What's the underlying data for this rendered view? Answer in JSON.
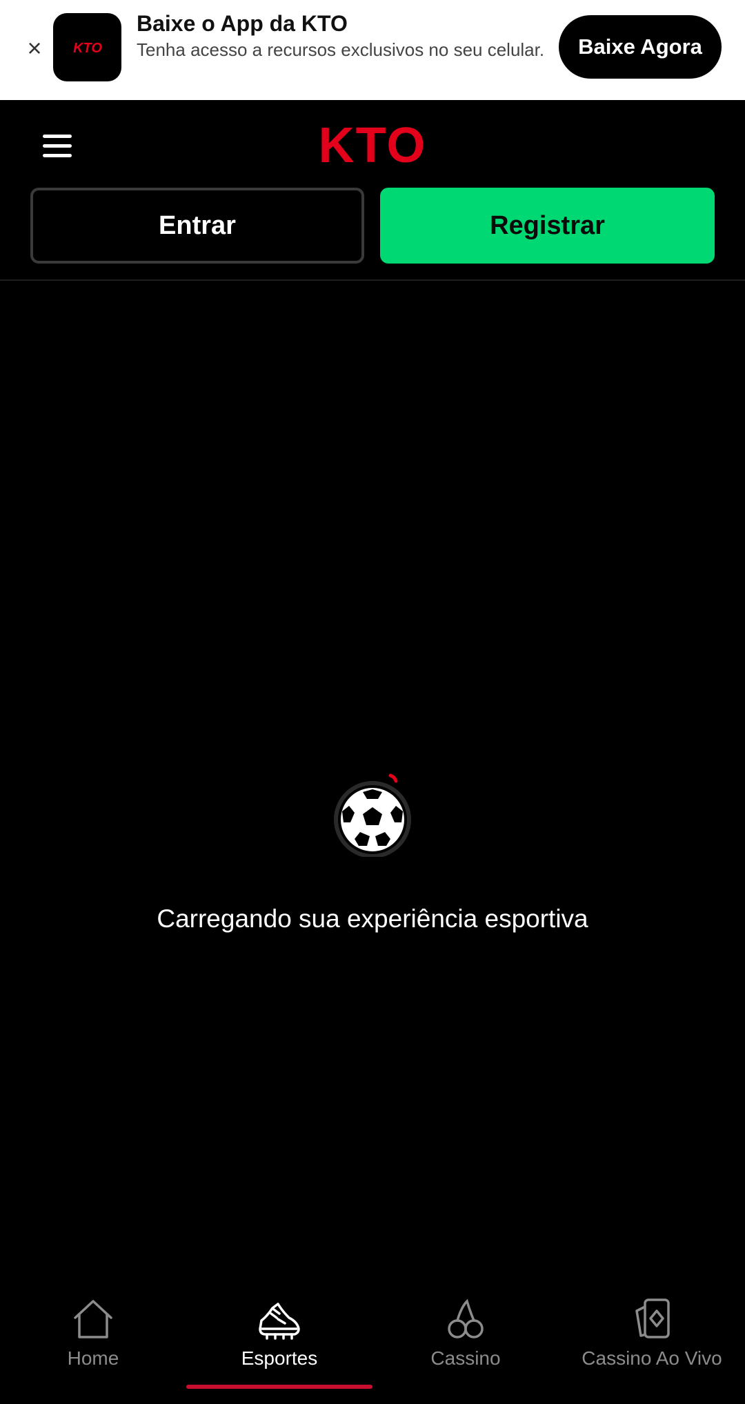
{
  "banner": {
    "close_icon": "×",
    "app_icon_text": "KTO",
    "title": "Baixe o App da KTO",
    "subtitle": "Tenha acesso a recursos exclusivos no seu celular.",
    "cta_label": "Baixe Agora"
  },
  "header": {
    "logo_text": "KTO",
    "login_label": "Entrar",
    "register_label": "Registrar"
  },
  "loading": {
    "message": "Carregando sua experiência esportiva"
  },
  "bottom_nav": {
    "items": [
      {
        "label": "Home",
        "icon": "home-icon",
        "active": false
      },
      {
        "label": "Esportes",
        "icon": "sneaker-icon",
        "active": true
      },
      {
        "label": "Cassino",
        "icon": "cherry-icon",
        "active": false
      },
      {
        "label": "Cassino Ao Vivo",
        "icon": "cards-icon",
        "active": false
      }
    ]
  },
  "colors": {
    "brand_red": "#e3001b",
    "register_green": "#00d873",
    "active_indicator": "#c8102e",
    "background": "#000000"
  }
}
